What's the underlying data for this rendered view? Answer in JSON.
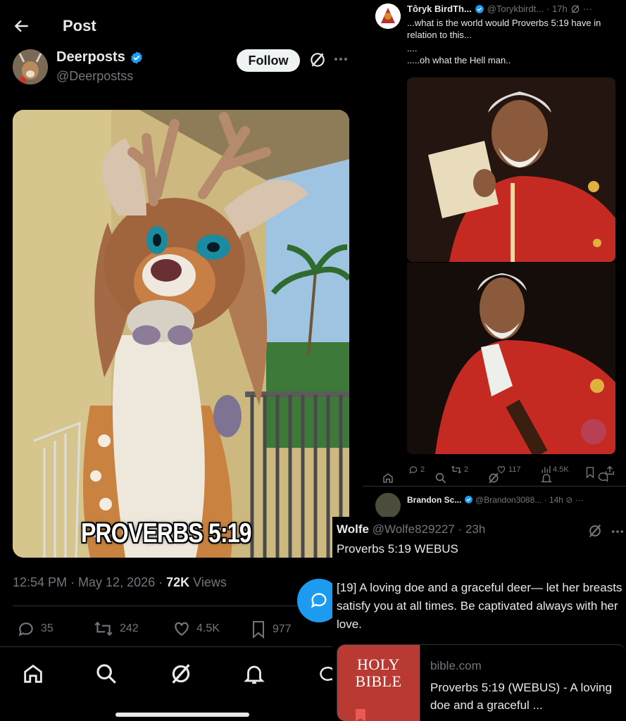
{
  "left_post": {
    "header_title": "Post",
    "author_name": "Deerposts",
    "author_handle": "@Deerpostss",
    "follow_label": "Follow",
    "image_caption": "PROVERBS 5:19",
    "time": "12:54 PM · May 12, 2026 · ",
    "views_count": "72K",
    "views_label": " Views",
    "actions": {
      "replies": "35",
      "reposts": "242",
      "likes": "4.5K",
      "bookmarks": "977"
    },
    "icons": [
      "back-arrow-icon",
      "verified-badge-icon",
      "grok-icon",
      "more-icon",
      "reply-icon",
      "repost-icon",
      "like-icon",
      "bookmark-icon",
      "compose-reply-icon",
      "home-icon",
      "search-icon",
      "grok-nav-icon",
      "notifications-icon",
      "messages-icon"
    ],
    "accent_color": "#1d9bf0"
  },
  "right_top_post": {
    "author_name": "Tôryk BirdTh...",
    "author_handle": "@Torykbirdt...",
    "time": "· 17h",
    "text_line1": "...what is the world would Proverbs 5:19 have in relation to this...",
    "text_line2": "....",
    "text_line3": ".....oh what the Hell man..",
    "actions": {
      "replies": "2",
      "reposts": "2",
      "likes": "117",
      "views": "4.5K"
    }
  },
  "brandon_reply": {
    "author_name": "Brandon Sc...",
    "author_handle": "@Brandon3088...",
    "time": "· 14h"
  },
  "wolfe_post": {
    "author_name": "Wolfe",
    "author_handle": "@Wolfe829227",
    "time": "· 23h",
    "line1": "Proverbs 5:19 WEBUS",
    "verse": "[19] A loving doe and a graceful deer— let her breasts satisfy you at all times. Be captivated always with her love.",
    "card_thumb_line1": "HOLY",
    "card_thumb_line2": "BIBLE",
    "card_domain": "bible.com",
    "card_title": "Proverbs 5:19 (WEBUS) - A loving doe and a graceful ..."
  }
}
